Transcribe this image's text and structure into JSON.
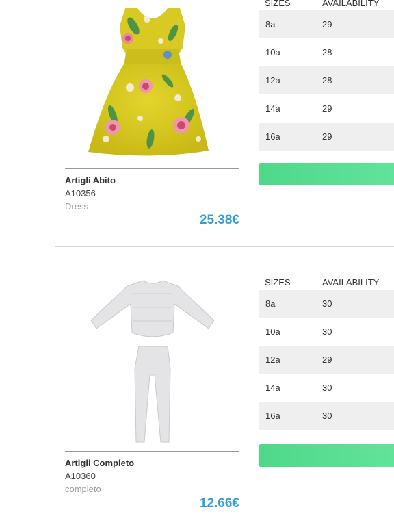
{
  "products": [
    {
      "name": "Artigli Abito",
      "code": "A10356",
      "type": "Dress",
      "price": "25.38€",
      "table_headers": {
        "sizes": "SIZES",
        "availability": "AVAILABILITY"
      },
      "rows": [
        {
          "size": "8a",
          "availability": "29"
        },
        {
          "size": "10a",
          "availability": "28"
        },
        {
          "size": "12a",
          "availability": "28"
        },
        {
          "size": "14a",
          "availability": "29"
        },
        {
          "size": "16a",
          "availability": "29"
        }
      ],
      "image_icon": "yellow-floral-dress-image"
    },
    {
      "name": "Artigli Completo",
      "code": "A10360",
      "type": "completo",
      "price": "12.66€",
      "table_headers": {
        "sizes": "SIZES",
        "availability": "AVAILABILITY"
      },
      "rows": [
        {
          "size": "8a",
          "availability": "30"
        },
        {
          "size": "10a",
          "availability": "30"
        },
        {
          "size": "12a",
          "availability": "29"
        },
        {
          "size": "14a",
          "availability": "30"
        },
        {
          "size": "16a",
          "availability": "30"
        }
      ],
      "image_icon": "grey-top-and-leggings-image"
    }
  ],
  "colors": {
    "price": "#2f9fd6",
    "button": "#5adc92",
    "row_shade": "#efefef"
  }
}
